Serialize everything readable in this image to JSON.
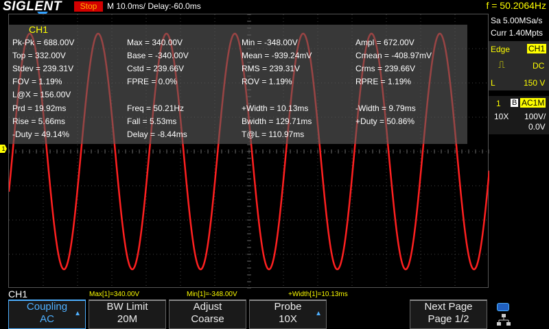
{
  "topbar": {
    "brand": "SIGLENT",
    "run_state": "Stop",
    "timebase": "M 10.0ms/ Delay:-60.0ms",
    "frequency": "f = 50.2064Hz"
  },
  "channel": {
    "label": "CH1",
    "marker": "1",
    "bottom_label": "CH1",
    "trace_color": "#ff2020"
  },
  "measurements": {
    "pkpk": "Pk-Pk = 688.00V",
    "max": "Max = 340.00V",
    "min": "Min = -348.00V",
    "ampl": "Ampl = 672.00V",
    "top": "Top = 332.00V",
    "base": "Base = -340.00V",
    "mean": "Mean = -939.24mV",
    "cmean": "Cmean = -408.97mV",
    "stdev": "Stdev = 239.31V",
    "cstd": "Cstd = 239.66V",
    "rms": "RMS = 239.31V",
    "crms": "Crms = 239.66V",
    "fov": "FOV = 1.19%",
    "fpre": "FPRE = 0.0%",
    "rov": "ROV = 1.19%",
    "rpre": "RPRE = 1.19%",
    "lx": "L@X = 156.00V",
    "prd": "Prd = 19.92ms",
    "freq": "Freq = 50.21Hz",
    "pwidth": "+Width = 10.13ms",
    "nwidth": "-Width = 9.79ms",
    "rise": "Rise = 5.66ms",
    "fall": "Fall = 5.53ms",
    "bwidth": "Bwidth = 129.71ms",
    "pduty": "+Duty = 50.86%",
    "nduty": "-Duty = 49.14%",
    "delay": "Delay = -8.44ms",
    "tl": "T@L = 110.97ms"
  },
  "right_panel": {
    "sample_rate": "Sa 5.00MSa/s",
    "memory": "Curr 1.40Mpts",
    "trigger_type": "Edge",
    "trigger_source": "CH1",
    "trigger_coupling": "DC",
    "trigger_level_label": "L",
    "trigger_level": "150 V",
    "ch_num": "1",
    "bw_flag": "B",
    "ch_coupling": "AC1M",
    "probe": "10X",
    "vdiv": "100V/",
    "offset": "0.0V"
  },
  "bottom_measures": {
    "max": "Max[1]=340.00V",
    "min": "Min[1]=-348.00V",
    "pwidth": "+Width[1]=10.13ms"
  },
  "softkeys": [
    {
      "line1": "Coupling",
      "line2": "AC"
    },
    {
      "line1": "BW Limit",
      "line2": "20M"
    },
    {
      "line1": "Adjust",
      "line2": "Coarse"
    },
    {
      "line1": "Probe",
      "line2": "10X"
    },
    {
      "line1": "Next Page",
      "line2": "Page 1/2"
    }
  ],
  "waveform": {
    "frequency_hz": 50.21,
    "amplitude_v": 344,
    "volts_per_div": 100,
    "ms_per_div": 10,
    "cycles_visible": 7
  }
}
